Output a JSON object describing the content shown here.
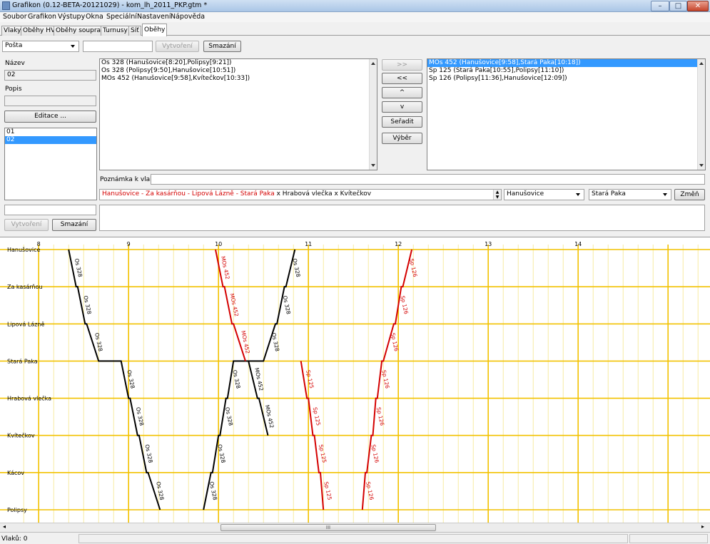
{
  "window": {
    "title": "Grafikon (0.12-BETA-20121029) - kom_lh_2011_PKP.gtm *",
    "minimize_icon": "minimize-icon",
    "maximize_icon": "maximize-icon",
    "close_icon": "close-icon"
  },
  "menu": [
    "Soubor",
    "Grafikon",
    "Výstupy",
    "Okna",
    "Speciální",
    "Nastavení",
    "Nápověda"
  ],
  "tabs": [
    {
      "label": "Vlaky",
      "active": false
    },
    {
      "label": "Oběhy HV",
      "active": false
    },
    {
      "label": "Oběhy souprav",
      "active": false
    },
    {
      "label": "Turnusy",
      "active": false
    },
    {
      "label": "Síť",
      "active": false
    },
    {
      "label": "Oběhy",
      "active": true
    }
  ],
  "toolbar": {
    "type_select": "Pošta",
    "name_input": "",
    "create_label": "Vytvoření",
    "delete_label": "Smazání"
  },
  "left_panel": {
    "name_label": "Název",
    "name_value": "02",
    "desc_label": "Popis",
    "desc_value": "",
    "edit_label": "Editace ...",
    "circulations": [
      {
        "label": "01",
        "selected": false
      },
      {
        "label": "02",
        "selected": true
      }
    ],
    "new_input": "",
    "create_label": "Vytvoření",
    "delete_label": "Smazání"
  },
  "available_trains": [
    "Os 328 (Hanušovice[8:20],Polipsy[9:21])",
    "Os 328 (Polipsy[9:50],Hanušovice[10:51])",
    "MOs 452 (Hanušovice[9:58],Kvítečkov[10:33])"
  ],
  "middle_buttons": {
    "add": ">>",
    "remove": "<<",
    "up": "^",
    "down": "v",
    "sort": "Seřadit",
    "select": "Výběr"
  },
  "assigned_trains": [
    {
      "label": "MOs 452 (Hanušovice[9:58],Stará Paka[10:18])",
      "selected": true
    },
    {
      "label": "Sp 125 (Stará Paka[10:55],Polipsy[11:10])",
      "selected": false
    },
    {
      "label": "Sp 126 (Polipsy[11:36],Hanušovice[12:09])",
      "selected": false
    }
  ],
  "note_label": "Poznámka k vlaku:",
  "note_value": "",
  "route": {
    "red_text": "Hanušovice - Za kasárňou - Lipová Lázně - Stará Paka",
    "rest_text": " x Hrabová vlečka x Kvítečkov",
    "from_select": "Hanušovice",
    "to_select": "Stará Paka",
    "change_label": "Změň"
  },
  "graph": {
    "hours": [
      "8",
      "9",
      "10",
      "11",
      "12",
      "13",
      "14"
    ],
    "stations": [
      "Hanušovice",
      "Za kasárňou",
      "Lipová Lázně",
      "Stará Paka",
      "Hrabová vlečka",
      "Kvítečkov",
      "Kácov",
      "Polipsy"
    ],
    "colors": {
      "grid_major": "#f2c200",
      "grid_minor": "#f5e68a",
      "normal_train": "#000000",
      "circulation_train": "#d40000"
    },
    "trains": [
      {
        "name": "Os 328",
        "color": "black",
        "points": [
          [
            "Hanušovice",
            "8:20"
          ],
          [
            "Za kasárňou",
            "8:25"
          ],
          [
            "Za kasárňou",
            "8:26"
          ],
          [
            "Lipová Lázně",
            "8:31"
          ],
          [
            "Lipová Lázně",
            "8:32"
          ],
          [
            "Stará Paka",
            "8:40"
          ],
          [
            "Stará Paka",
            "8:55"
          ],
          [
            "Hrabová vlečka",
            "9:00"
          ],
          [
            "Hrabová vlečka",
            "9:01"
          ],
          [
            "Kvítečkov",
            "9:06"
          ],
          [
            "Kvítečkov",
            "9:07"
          ],
          [
            "Kácov",
            "9:12"
          ],
          [
            "Kácov",
            "9:13"
          ],
          [
            "Polipsy",
            "9:21"
          ]
        ]
      },
      {
        "name": "Os 328",
        "color": "black",
        "points": [
          [
            "Polipsy",
            "9:50"
          ],
          [
            "Kácov",
            "9:55"
          ],
          [
            "Kácov",
            "9:56"
          ],
          [
            "Kvítečkov",
            "10:00"
          ],
          [
            "Kvítečkov",
            "10:01"
          ],
          [
            "Hrabová vlečka",
            "10:05"
          ],
          [
            "Hrabová vlečka",
            "10:06"
          ],
          [
            "Stará Paka",
            "10:10"
          ],
          [
            "Stará Paka",
            "10:30"
          ],
          [
            "Lipová Lázně",
            "10:38"
          ],
          [
            "Lipová Lázně",
            "10:39"
          ],
          [
            "Za kasárňou",
            "10:44"
          ],
          [
            "Za kasárňou",
            "10:45"
          ],
          [
            "Hanušovice",
            "10:51"
          ]
        ]
      },
      {
        "name": "MOs 452",
        "color": "red",
        "points": [
          [
            "Hanušovice",
            "9:58"
          ],
          [
            "Za kasárňou",
            "10:03"
          ],
          [
            "Za kasárňou",
            "10:04"
          ],
          [
            "Lipová Lázně",
            "10:09"
          ],
          [
            "Lipová Lázně",
            "10:10"
          ],
          [
            "Stará Paka",
            "10:18"
          ]
        ]
      },
      {
        "name": "MOs 452",
        "color": "black",
        "points": [
          [
            "Stará Paka",
            "10:20"
          ],
          [
            "Hrabová vlečka",
            "10:26"
          ],
          [
            "Hrabová vlečka",
            "10:27"
          ],
          [
            "Kvítečkov",
            "10:33"
          ]
        ]
      },
      {
        "name": "Sp 125",
        "color": "red",
        "points": [
          [
            "Stará Paka",
            "10:55"
          ],
          [
            "Hrabová vlečka",
            "10:59"
          ],
          [
            "Hrabová vlečka",
            "11:00"
          ],
          [
            "Kvítečkov",
            "11:03"
          ],
          [
            "Kvítečkov",
            "11:04"
          ],
          [
            "Kácov",
            "11:07"
          ],
          [
            "Kácov",
            "11:08"
          ],
          [
            "Polipsy",
            "11:10"
          ]
        ]
      },
      {
        "name": "Sp 126",
        "color": "red",
        "points": [
          [
            "Polipsy",
            "11:36"
          ],
          [
            "Kácov",
            "11:38"
          ],
          [
            "Kácov",
            "11:39"
          ],
          [
            "Kvítečkov",
            "11:42"
          ],
          [
            "Kvítečkov",
            "11:43"
          ],
          [
            "Hrabová vlečka",
            "11:45"
          ],
          [
            "Hrabová vlečka",
            "11:46"
          ],
          [
            "Stará Paka",
            "11:49"
          ],
          [
            "Stará Paka",
            "11:50"
          ],
          [
            "Lipová Lázně",
            "11:57"
          ],
          [
            "Lipová Lázně",
            "11:58"
          ],
          [
            "Za kasárňou",
            "12:02"
          ],
          [
            "Za kasárňou",
            "12:03"
          ],
          [
            "Hanušovice",
            "12:09"
          ]
        ]
      }
    ]
  },
  "hscroll_thumb": "III",
  "status": "Vlaků: 0"
}
